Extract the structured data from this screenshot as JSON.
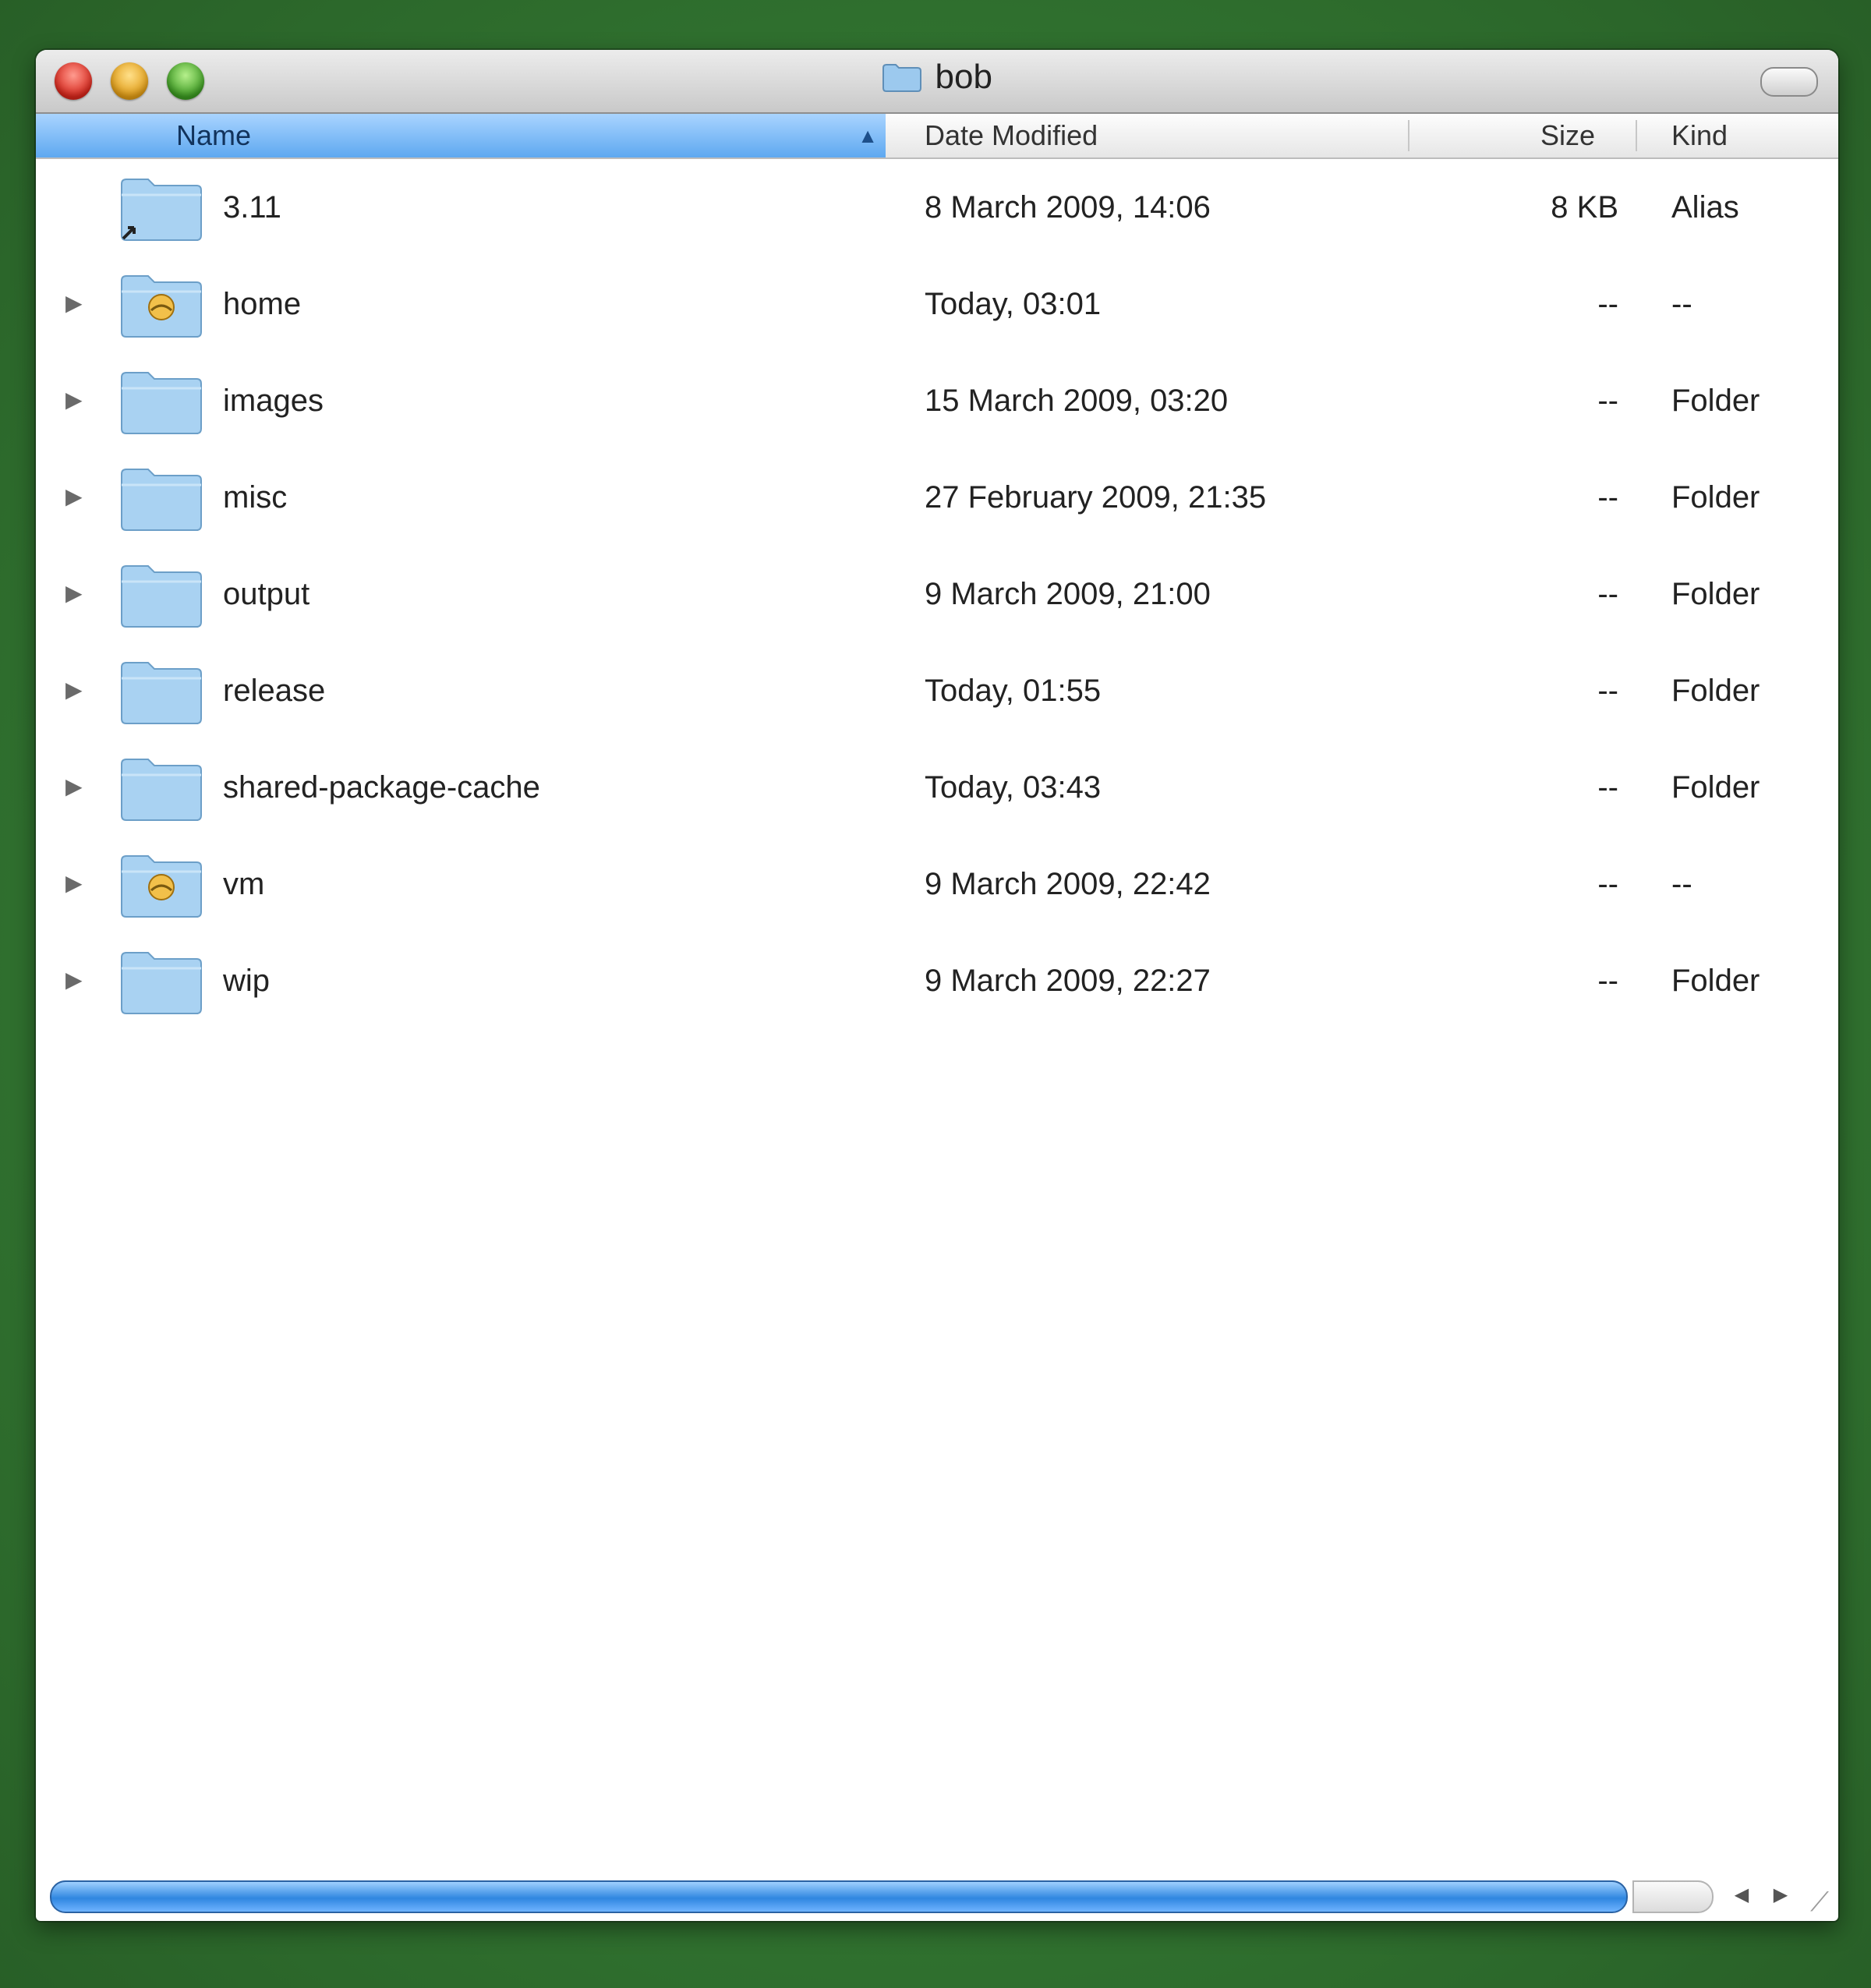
{
  "window": {
    "title": "bob"
  },
  "columns": {
    "name": "Name",
    "date": "Date Modified",
    "size": "Size",
    "kind": "Kind"
  },
  "rows": [
    {
      "name": "3.11",
      "date": "8 March 2009, 14:06",
      "size": "8 KB",
      "kind": "Alias",
      "icon": "alias-folder-icon",
      "expandable": false
    },
    {
      "name": "home",
      "date": "Today, 03:01",
      "size": "--",
      "kind": "--",
      "icon": "home-folder-icon",
      "expandable": true
    },
    {
      "name": "images",
      "date": "15 March 2009, 03:20",
      "size": "--",
      "kind": "Folder",
      "icon": "folder-icon",
      "expandable": true
    },
    {
      "name": "misc",
      "date": "27 February 2009, 21:35",
      "size": "--",
      "kind": "Folder",
      "icon": "folder-icon",
      "expandable": true
    },
    {
      "name": "output",
      "date": "9 March 2009, 21:00",
      "size": "--",
      "kind": "Folder",
      "icon": "folder-icon",
      "expandable": true
    },
    {
      "name": "release",
      "date": "Today, 01:55",
      "size": "--",
      "kind": "Folder",
      "icon": "folder-icon",
      "expandable": true
    },
    {
      "name": "shared-package-cache",
      "date": "Today, 03:43",
      "size": "--",
      "kind": "Folder",
      "icon": "folder-icon",
      "expandable": true
    },
    {
      "name": "vm",
      "date": "9 March 2009, 22:42",
      "size": "--",
      "kind": "--",
      "icon": "home-folder-icon",
      "expandable": true
    },
    {
      "name": "wip",
      "date": "9 March 2009, 22:27",
      "size": "--",
      "kind": "Folder",
      "icon": "folder-icon",
      "expandable": true
    }
  ],
  "colors": {
    "selected_header": "#5ea8f0",
    "folder": "#8fc2ea",
    "desktop": "#2f6f2e"
  }
}
